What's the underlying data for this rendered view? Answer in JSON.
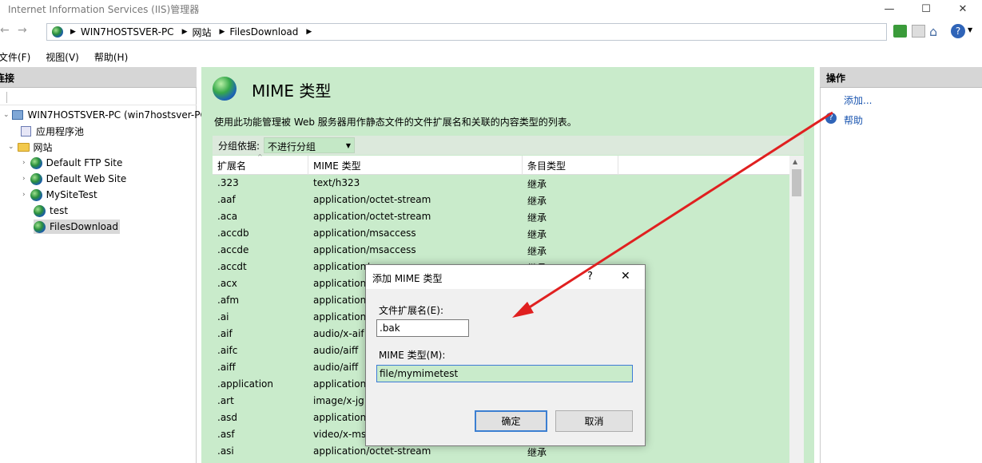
{
  "window": {
    "title": "Internet Information Services (IIS)管理器",
    "minimize": "—",
    "maximize": "☐",
    "close": "✕"
  },
  "address": {
    "crumbs": [
      "WIN7HOSTSVER-PC",
      "网站",
      "FilesDownload"
    ],
    "separator": "▶"
  },
  "menu": {
    "file": "文件(F)",
    "view": "视图(V)",
    "help": "帮助(H)"
  },
  "left": {
    "header": "连接",
    "server": "WIN7HOSTSVER-PC (win7hostsver-PC",
    "app_pools": "应用程序池",
    "sites": "网站",
    "site_items": [
      "Default FTP Site",
      "Default Web Site",
      "MySiteTest",
      "test",
      "FilesDownload"
    ]
  },
  "center": {
    "title": "MIME 类型",
    "description": "使用此功能管理被 Web 服务器用作静态文件的文件扩展名和关联的内容类型的列表。",
    "group_label": "分组依据:",
    "group_value": "不进行分组",
    "columns": [
      "扩展名",
      "MIME 类型",
      "条目类型"
    ],
    "rows": [
      [
        ".323",
        "text/h323",
        "继承"
      ],
      [
        ".aaf",
        "application/octet-stream",
        "继承"
      ],
      [
        ".aca",
        "application/octet-stream",
        "继承"
      ],
      [
        ".accdb",
        "application/msaccess",
        "继承"
      ],
      [
        ".accde",
        "application/msaccess",
        "继承"
      ],
      [
        ".accdt",
        "application/",
        "继承"
      ],
      [
        ".acx",
        "application",
        ""
      ],
      [
        ".afm",
        "application",
        ""
      ],
      [
        ".ai",
        "application",
        ""
      ],
      [
        ".aif",
        "audio/x-aif",
        ""
      ],
      [
        ".aifc",
        "audio/aiff",
        ""
      ],
      [
        ".aiff",
        "audio/aiff",
        ""
      ],
      [
        ".application",
        "application",
        ""
      ],
      [
        ".art",
        "image/x-jg",
        ""
      ],
      [
        ".asd",
        "application",
        ""
      ],
      [
        ".asf",
        "video/x-ms",
        ""
      ],
      [
        ".asi",
        "application/octet-stream",
        "继承"
      ]
    ]
  },
  "right": {
    "header": "操作",
    "add": "添加...",
    "help": "帮助"
  },
  "dialog": {
    "title": "添加 MIME 类型",
    "help_btn": "?",
    "close_btn": "✕",
    "ext_label": "文件扩展名(E):",
    "ext_value": ".bak",
    "mime_label": "MIME 类型(M):",
    "mime_value": "file/mymimetest",
    "ok": "确定",
    "cancel": "取消"
  },
  "colors": {
    "content_bg": "#c9ebcb",
    "annotation_arrow": "#e02020",
    "link": "#1a55b0"
  }
}
